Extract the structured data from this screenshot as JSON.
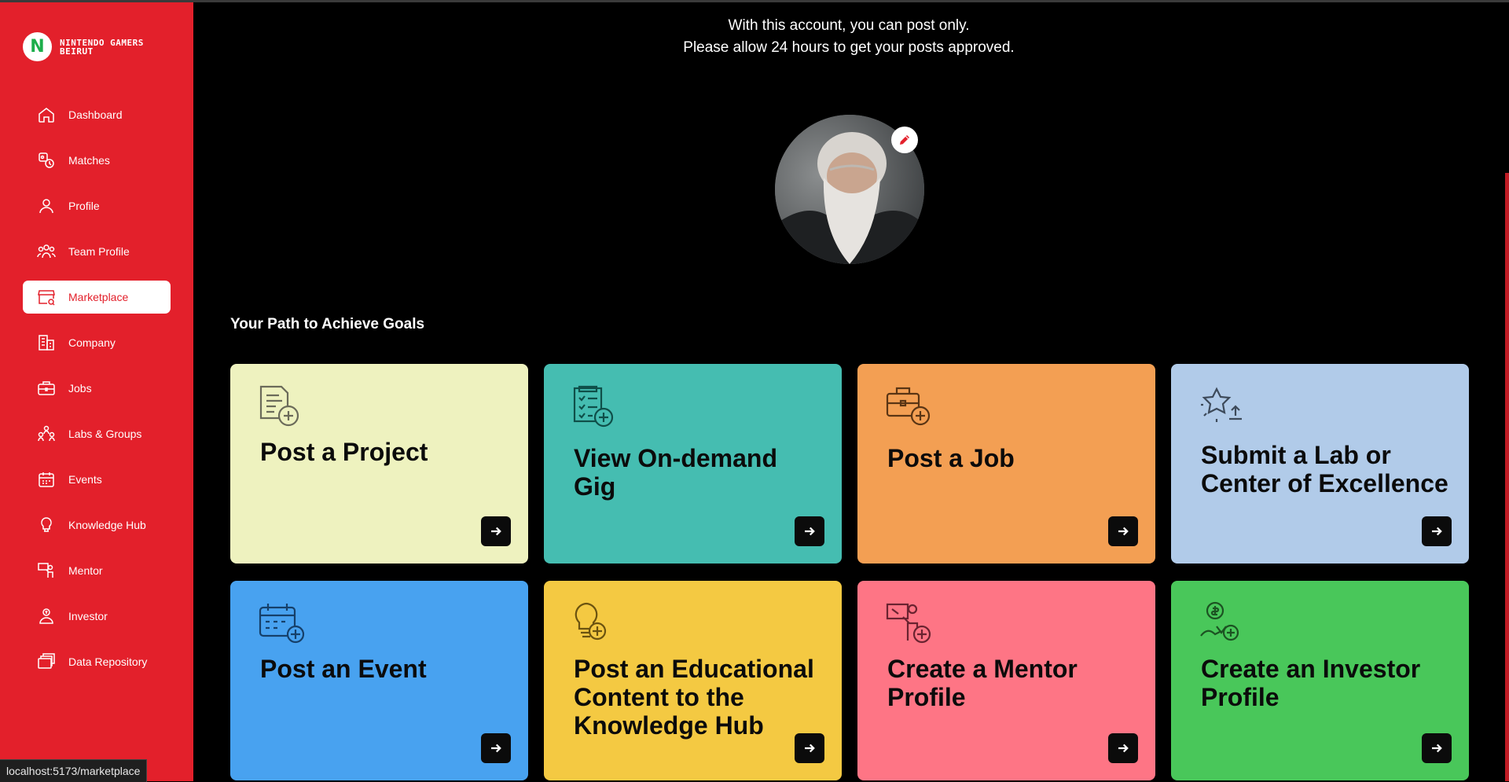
{
  "brand": {
    "initial": "N",
    "name": "NINTENDO GAMERS BEIRUT"
  },
  "sidebar": {
    "items": [
      {
        "label": "Dashboard",
        "icon": "home-icon"
      },
      {
        "label": "Matches",
        "icon": "matches-icon"
      },
      {
        "label": "Profile",
        "icon": "user-icon"
      },
      {
        "label": "Team Profile",
        "icon": "team-icon"
      },
      {
        "label": "Marketplace",
        "icon": "store-icon",
        "active": true
      },
      {
        "label": "Company",
        "icon": "building-icon"
      },
      {
        "label": "Jobs",
        "icon": "briefcase-icon"
      },
      {
        "label": "Labs & Groups",
        "icon": "groups-icon"
      },
      {
        "label": "Events",
        "icon": "calendar-icon"
      },
      {
        "label": "Knowledge Hub",
        "icon": "lightbulb-icon"
      },
      {
        "label": "Mentor",
        "icon": "mentor-icon"
      },
      {
        "label": "Investor",
        "icon": "investor-icon"
      },
      {
        "label": "Data Repository",
        "icon": "folders-icon"
      }
    ]
  },
  "notice": {
    "line1": "With this account, you can post only.",
    "line2": "Please allow 24 hours to get your posts approved."
  },
  "section_title": "Your Path to Achieve Goals",
  "cards": [
    {
      "title": "Post a Project",
      "icon": "document-add-icon",
      "color": "#eef2bf"
    },
    {
      "title": "View On-demand Gig",
      "icon": "checklist-add-icon",
      "color": "#45bdb1"
    },
    {
      "title": "Post a Job",
      "icon": "briefcase-add-icon",
      "color": "#f39f53"
    },
    {
      "title": "Submit a Lab or Center of Excellence",
      "icon": "star-upload-icon",
      "color": "#b1cbe9"
    },
    {
      "title": "Post an Event",
      "icon": "calendar-add-icon",
      "color": "#48a2f0"
    },
    {
      "title": "Post an Educational Content to the Knowledge Hub",
      "icon": "lightbulb-add-icon",
      "color": "#f4c942"
    },
    {
      "title": "Create a Mentor Profile",
      "icon": "presenter-add-icon",
      "color": "#fe7585"
    },
    {
      "title": "Create an Investor Profile",
      "icon": "investor-add-icon",
      "color": "#49c75a"
    }
  ],
  "status_url": "localhost:5173/marketplace",
  "colors": {
    "sidebar": "#e3202b",
    "background": "#000000",
    "accent": "#e3202b"
  }
}
